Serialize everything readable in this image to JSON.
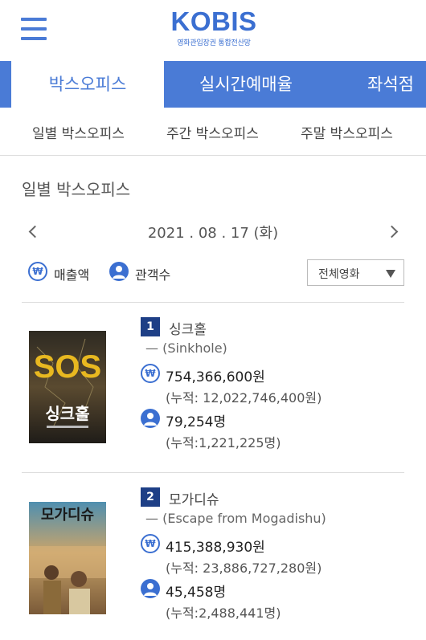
{
  "header": {
    "logo": "KOBIS",
    "logo_sub": "영화관입장권 통합전산망"
  },
  "tabs": [
    {
      "label": "박스오피스"
    },
    {
      "label": "실시간예매율"
    },
    {
      "label": "좌석점"
    }
  ],
  "subnav": [
    {
      "label": "일별 박스오피스"
    },
    {
      "label": "주간 박스오피스"
    },
    {
      "label": "주말 박스오피스"
    }
  ],
  "section_title": "일별 박스오피스",
  "date": "2021 . 08 . 17 (화)",
  "legend": {
    "revenue": "매출액",
    "audience": "관객수"
  },
  "filter": {
    "selected": "전체영화"
  },
  "movies": [
    {
      "rank": "1",
      "title": "싱크홀",
      "subtitle": "—  (Sinkhole)",
      "revenue": "754,366,600원",
      "revenue_acc": "(누적: 12,022,746,400원)",
      "audience": "79,254명",
      "audience_acc": "(누적:1,221,225명)",
      "poster": {
        "top_text": "SOS",
        "bottom_text": "싱크홀"
      }
    },
    {
      "rank": "2",
      "title": "모가디슈",
      "subtitle": "—  (Escape from Mogadishu)",
      "revenue": "415,388,930원",
      "revenue_acc": "(누적: 23,886,727,280원)",
      "audience": "45,458명",
      "audience_acc": "(누적:2,488,441명)",
      "poster": {
        "top_text": "모가디슈"
      }
    }
  ],
  "colors": {
    "accent": "#4a7bd6",
    "rank_bg": "#1e3f86"
  }
}
